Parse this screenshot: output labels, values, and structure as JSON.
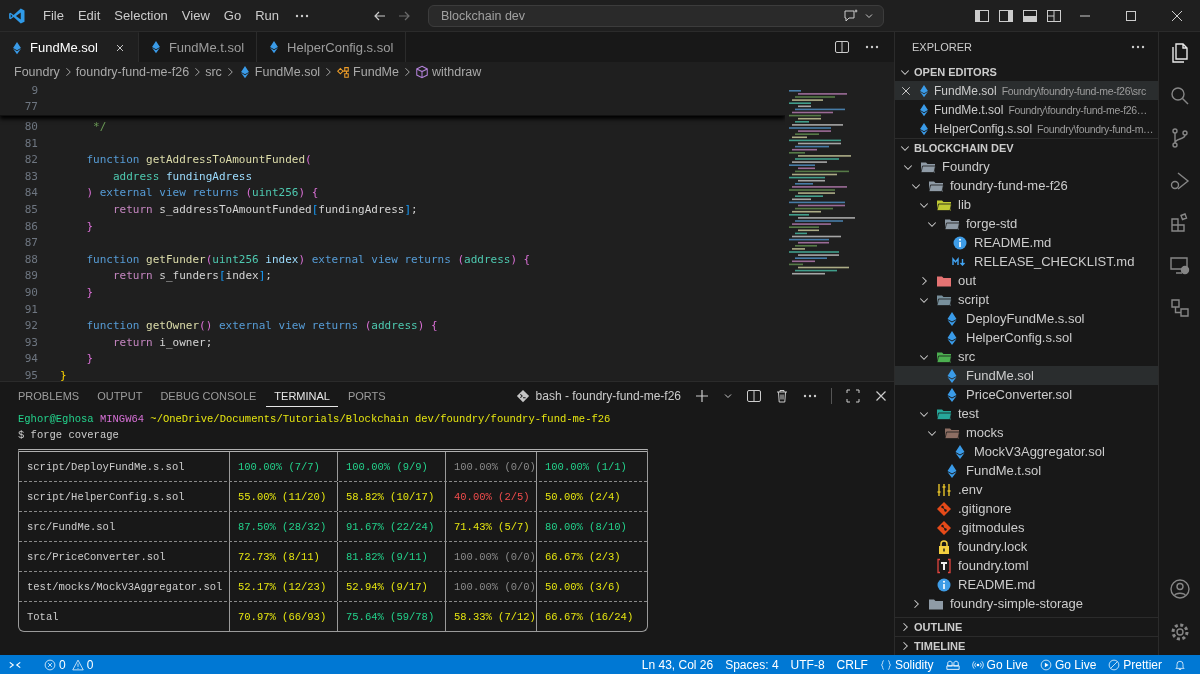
{
  "title_bar": {
    "menu": [
      "File",
      "Edit",
      "Selection",
      "View",
      "Go",
      "Run"
    ],
    "search": "Blockchain dev"
  },
  "tabs": [
    {
      "label": "FundMe.sol",
      "selected": true
    },
    {
      "label": "FundMe.t.sol",
      "selected": false
    },
    {
      "label": "HelperConfig.s.sol",
      "selected": false
    }
  ],
  "breadcrumbs": [
    {
      "kind": "folder",
      "text": "Foundry"
    },
    {
      "kind": "folder",
      "text": "foundry-fund-me-f26"
    },
    {
      "kind": "folder",
      "text": "src"
    },
    {
      "kind": "file",
      "text": "FundMe.sol"
    },
    {
      "kind": "contract",
      "text": "FundMe"
    },
    {
      "kind": "method",
      "text": "withdraw"
    }
  ],
  "editor": {
    "sticky_lines": [
      {
        "num": "9"
      },
      {
        "num": "77"
      }
    ],
    "lines": [
      {
        "num": "80",
        "tokens": [
          {
            "kind": "comment",
            "text": "     */"
          }
        ]
      },
      {
        "num": "81"
      },
      {
        "num": "82",
        "tokens": [
          {
            "kind": "keyword",
            "text": "    function "
          },
          {
            "kind": "function",
            "text": "getAddressToAmountFunded"
          },
          {
            "kind": "bracket1",
            "text": "("
          }
        ]
      },
      {
        "num": "83",
        "tokens": [
          {
            "kind": "type",
            "text": "        address "
          },
          {
            "kind": "param",
            "text": "fundingAdress"
          }
        ]
      },
      {
        "num": "84",
        "tokens": [
          {
            "kind": "bracket1",
            "text": "    )"
          },
          {
            "kind": "keyword",
            "text": " external view returns "
          },
          {
            "kind": "bracket1",
            "text": "("
          },
          {
            "kind": "type",
            "text": "uint256"
          },
          {
            "kind": "bracket1",
            "text": ")"
          },
          {
            "kind": "bracket1",
            "text": " {"
          }
        ]
      },
      {
        "num": "85",
        "tokens": [
          {
            "kind": "control",
            "text": "        return "
          },
          {
            "kind": "plain",
            "text": "s_addressToAmountFunded"
          },
          {
            "kind": "bracket2",
            "text": "["
          },
          {
            "kind": "plain",
            "text": "fundingAdress"
          },
          {
            "kind": "bracket2",
            "text": "]"
          },
          {
            "kind": "plain",
            "text": ";"
          }
        ]
      },
      {
        "num": "86",
        "tokens": [
          {
            "kind": "bracket1",
            "text": "    }"
          }
        ]
      },
      {
        "num": "87"
      },
      {
        "num": "88",
        "tokens": [
          {
            "kind": "keyword",
            "text": "    function "
          },
          {
            "kind": "function",
            "text": "getFunder"
          },
          {
            "kind": "bracket1",
            "text": "("
          },
          {
            "kind": "type",
            "text": "uint256 "
          },
          {
            "kind": "param",
            "text": "index"
          },
          {
            "kind": "bracket1",
            "text": ")"
          },
          {
            "kind": "keyword",
            "text": " external view returns "
          },
          {
            "kind": "bracket1",
            "text": "("
          },
          {
            "kind": "type",
            "text": "address"
          },
          {
            "kind": "bracket1",
            "text": ")"
          },
          {
            "kind": "bracket1",
            "text": " {"
          }
        ]
      },
      {
        "num": "89",
        "tokens": [
          {
            "kind": "control",
            "text": "        return "
          },
          {
            "kind": "plain",
            "text": "s_funders"
          },
          {
            "kind": "bracket2",
            "text": "["
          },
          {
            "kind": "plain",
            "text": "index"
          },
          {
            "kind": "bracket2",
            "text": "]"
          },
          {
            "kind": "plain",
            "text": ";"
          }
        ]
      },
      {
        "num": "90",
        "tokens": [
          {
            "kind": "bracket1",
            "text": "    }"
          }
        ]
      },
      {
        "num": "91"
      },
      {
        "num": "92",
        "tokens": [
          {
            "kind": "keyword",
            "text": "    function "
          },
          {
            "kind": "function",
            "text": "getOwner"
          },
          {
            "kind": "bracket1",
            "text": "()"
          },
          {
            "kind": "keyword",
            "text": " external view returns "
          },
          {
            "kind": "bracket1",
            "text": "("
          },
          {
            "kind": "type",
            "text": "address"
          },
          {
            "kind": "bracket1",
            "text": ")"
          },
          {
            "kind": "bracket1",
            "text": " {"
          }
        ]
      },
      {
        "num": "93",
        "tokens": [
          {
            "kind": "control",
            "text": "        return "
          },
          {
            "kind": "plain",
            "text": "i_owner;"
          }
        ]
      },
      {
        "num": "94",
        "tokens": [
          {
            "kind": "bracket1",
            "text": "    }"
          }
        ]
      },
      {
        "num": "95",
        "tokens": [
          {
            "kind": "bracket0",
            "text": "}"
          }
        ]
      }
    ]
  },
  "panel": {
    "tabs": [
      {
        "label": "PROBLEMS",
        "selected": false
      },
      {
        "label": "OUTPUT",
        "selected": false
      },
      {
        "label": "DEBUG CONSOLE",
        "selected": false
      },
      {
        "label": "TERMINAL",
        "selected": true
      },
      {
        "label": "PORTS",
        "selected": false
      }
    ],
    "terminal_name": "bash - foundry-fund-me-f26",
    "prompt": {
      "user": "Eghor@Eghosa",
      "system": "MINGW64",
      "path": "~/OneDrive/Documents/Tutorials/Blockchain dev/foundry/foundry-fund-me-f26"
    },
    "command": "$ forge coverage",
    "coverage_rows": [
      {
        "file": "script/DeployFundMe.s.sol",
        "cells": [
          {
            "text": "100.00% (7/7)",
            "kind": "good"
          },
          {
            "text": "100.00% (9/9)",
            "kind": "good"
          },
          {
            "text": "100.00% (0/0)",
            "kind": "none"
          },
          {
            "text": "100.00% (1/1)",
            "kind": "good"
          }
        ]
      },
      {
        "file": "script/HelperConfig.s.sol",
        "cells": [
          {
            "text": "55.00% (11/20)",
            "kind": "warn"
          },
          {
            "text": "58.82% (10/17)",
            "kind": "warn"
          },
          {
            "text": "40.00% (2/5)",
            "kind": "bad"
          },
          {
            "text": "50.00% (2/4)",
            "kind": "warn"
          }
        ]
      },
      {
        "file": "src/FundMe.sol",
        "cells": [
          {
            "text": "87.50% (28/32)",
            "kind": "good"
          },
          {
            "text": "91.67% (22/24)",
            "kind": "good"
          },
          {
            "text": "71.43% (5/7)",
            "kind": "warn"
          },
          {
            "text": "80.00% (8/10)",
            "kind": "good"
          }
        ]
      },
      {
        "file": "src/PriceConverter.sol",
        "cells": [
          {
            "text": "72.73% (8/11)",
            "kind": "warn"
          },
          {
            "text": "81.82% (9/11)",
            "kind": "good"
          },
          {
            "text": "100.00% (0/0)",
            "kind": "none"
          },
          {
            "text": "66.67% (2/3)",
            "kind": "warn"
          }
        ]
      },
      {
        "file": "test/mocks/MockV3Aggregator.sol",
        "cells": [
          {
            "text": "52.17% (12/23)",
            "kind": "warn"
          },
          {
            "text": "52.94% (9/17)",
            "kind": "warn"
          },
          {
            "text": "100.00% (0/0)",
            "kind": "none"
          },
          {
            "text": "50.00% (3/6)",
            "kind": "warn"
          }
        ]
      },
      {
        "file": "Total",
        "cells": [
          {
            "text": "70.97% (66/93)",
            "kind": "warn"
          },
          {
            "text": "75.64% (59/78)",
            "kind": "good"
          },
          {
            "text": "58.33% (7/12)",
            "kind": "warn"
          },
          {
            "text": "66.67% (16/24)",
            "kind": "warn"
          }
        ]
      }
    ]
  },
  "explorer": {
    "title": "EXPLORER",
    "open_editors": {
      "title": "OPEN EDITORS",
      "expanded": true,
      "items": [
        {
          "name": "FundMe.sol",
          "path": "Foundry\\foundry-fund-me-f26\\src",
          "selected": true
        },
        {
          "name": "FundMe.t.sol",
          "path": "Foundry\\foundry-fund-me-f26…",
          "selected": false
        },
        {
          "name": "HelperConfig.s.sol",
          "path": "Foundry\\foundry-fund-m…",
          "selected": false
        }
      ]
    },
    "folder": {
      "title": "BLOCKCHAIN DEV",
      "expanded": true,
      "tree": [
        {
          "name": "Foundry",
          "kind": "folder",
          "expanded": true,
          "selected": false,
          "children": [
            {
              "name": "foundry-fund-me-f26",
              "kind": "folder",
              "expanded": true,
              "selected": false,
              "children": [
                {
                  "name": "lib",
                  "kind": "lib",
                  "expanded": true,
                  "selected": false,
                  "children": [
                    {
                      "name": "forge-std",
                      "kind": "folder",
                      "expanded": true,
                      "selected": false,
                      "children": [
                        {
                          "name": "README.md",
                          "kind": "info",
                          "selected": false
                        },
                        {
                          "name": "RELEASE_CHECKLIST.md",
                          "kind": "markdown",
                          "selected": false
                        }
                      ]
                    }
                  ]
                },
                {
                  "name": "out",
                  "kind": "out",
                  "expanded": false,
                  "selected": false
                },
                {
                  "name": "script",
                  "kind": "script",
                  "expanded": true,
                  "selected": false,
                  "children": [
                    {
                      "name": "DeployFundMe.s.sol",
                      "kind": "solidity",
                      "selected": false
                    },
                    {
                      "name": "HelperConfig.s.sol",
                      "kind": "solidity",
                      "selected": false
                    }
                  ]
                },
                {
                  "name": "src",
                  "kind": "src",
                  "expanded": true,
                  "selected": false,
                  "children": [
                    {
                      "name": "FundMe.sol",
                      "kind": "solidity",
                      "selected": true
                    },
                    {
                      "name": "PriceConverter.sol",
                      "kind": "solidity",
                      "selected": false
                    }
                  ]
                },
                {
                  "name": "test",
                  "kind": "test",
                  "expanded": true,
                  "selected": false,
                  "children": [
                    {
                      "name": "mocks",
                      "kind": "mocks",
                      "expanded": true,
                      "selected": false,
                      "children": [
                        {
                          "name": "MockV3Aggregator.sol",
                          "kind": "solidity",
                          "selected": false
                        }
                      ]
                    },
                    {
                      "name": "FundMe.t.sol",
                      "kind": "solidity",
                      "selected": false
                    }
                  ]
                },
                {
                  "name": ".env",
                  "kind": "env",
                  "selected": false
                },
                {
                  "name": ".gitignore",
                  "kind": "git",
                  "selected": false
                },
                {
                  "name": ".gitmodules",
                  "kind": "git",
                  "selected": false
                },
                {
                  "name": "foundry.lock",
                  "kind": "lock",
                  "selected": false
                },
                {
                  "name": "foundry.toml",
                  "kind": "toml",
                  "selected": false
                },
                {
                  "name": "README.md",
                  "kind": "info",
                  "selected": false
                }
              ]
            },
            {
              "name": "foundry-simple-storage",
              "kind": "folder",
              "expanded": false,
              "selected": false
            }
          ]
        }
      ]
    },
    "outline": {
      "title": "OUTLINE",
      "expanded": false
    },
    "timeline": {
      "title": "TIMELINE",
      "expanded": false
    }
  },
  "activity_bar": {
    "top": [
      {
        "kind": "files",
        "selected": true
      },
      {
        "kind": "search",
        "selected": false
      },
      {
        "kind": "branch",
        "selected": false
      },
      {
        "kind": "debug",
        "selected": false
      },
      {
        "kind": "extensions",
        "selected": false
      },
      {
        "kind": "remote",
        "selected": false
      },
      {
        "kind": "flow",
        "selected": false
      }
    ],
    "bottom": [
      {
        "kind": "account",
        "selected": false
      },
      {
        "kind": "gear",
        "selected": false
      }
    ]
  },
  "status_bar": {
    "left": [
      {
        "kind": "error",
        "text": "0"
      },
      {
        "kind": "warning",
        "text": "0"
      }
    ],
    "right": [
      {
        "kind": "text",
        "text": "Ln 43, Col 26"
      },
      {
        "kind": "text",
        "text": "Spaces: 4"
      },
      {
        "kind": "text",
        "text": "UTF-8"
      },
      {
        "kind": "text",
        "text": "CRLF"
      },
      {
        "kind": "braces",
        "text": "Solidity"
      },
      {
        "kind": "goggles"
      },
      {
        "kind": "broadcast",
        "text": "Go Live"
      },
      {
        "kind": "play",
        "text": "Go Live"
      },
      {
        "kind": "slash",
        "text": "Prettier"
      },
      {
        "kind": "bell"
      }
    ]
  }
}
